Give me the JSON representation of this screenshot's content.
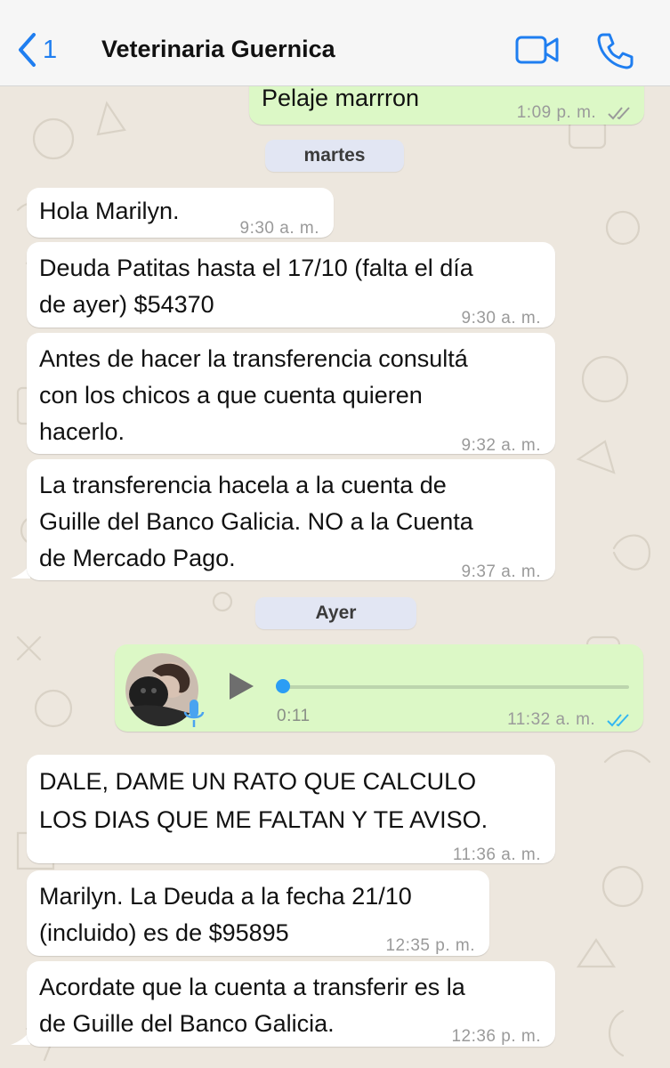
{
  "colors": {
    "accent": "#1f7ef0",
    "incoming_bubble": "#ffffff",
    "outgoing_bubble": "#dcf8c6",
    "read_ticks": "#34b7f1",
    "delivered_ticks": "#9a9a9a",
    "header_bg": "#f6f6f6"
  },
  "header": {
    "back_count": "1",
    "contact_name": "Veterinaria Guernica",
    "icons": [
      "chevron-left-icon",
      "video-camera-icon",
      "phone-icon"
    ]
  },
  "messages": [
    {
      "dir": "out",
      "text": "Pelaje marrron",
      "time": "1:09 p. m.",
      "status": "delivered"
    },
    {
      "type": "day",
      "label": "martes"
    },
    {
      "dir": "in",
      "text": "Hola Marilyn.",
      "time": "9:30 a. m."
    },
    {
      "dir": "in",
      "text": "Deuda Patitas hasta el 17/10 (falta el día\nde ayer) $54370",
      "time": "9:30 a. m."
    },
    {
      "dir": "in",
      "text": "Antes de hacer la transferencia consultá\ncon los chicos a que cuenta quieren\nhacerlo.",
      "time": "9:32 a. m."
    },
    {
      "dir": "in",
      "text": "La transferencia hacela a la cuenta de\nGuille del Banco Galicia. NO a la Cuenta\nde Mercado Pago.",
      "time": "9:37 a. m."
    },
    {
      "type": "day",
      "label": "Ayer"
    },
    {
      "dir": "out",
      "type": "voice",
      "duration": "0:11",
      "time": "11:32 a. m.",
      "status": "read",
      "progress": 0
    },
    {
      "dir": "in",
      "text": "DALE, DAME UN RATO QUE CALCULO\nLOS DIAS QUE ME FALTAN Y TE AVISO.",
      "time": "11:36 a. m."
    },
    {
      "dir": "in",
      "text": "Marilyn. La Deuda a la fecha 21/10\n(incluido) es de $95895",
      "time": "12:35 p. m."
    },
    {
      "dir": "in",
      "text": "Acordate que la cuenta a transferir es la\nde Guille del Banco Galicia.",
      "time": "12:36 p. m."
    }
  ]
}
